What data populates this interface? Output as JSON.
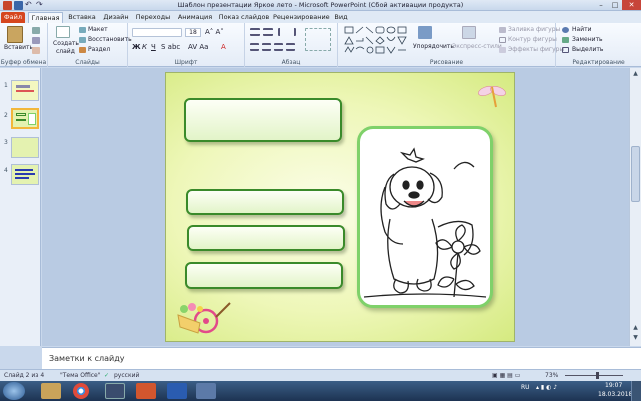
{
  "window": {
    "title": "Шаблон презентации Яркое лето  -  Microsoft PowerPoint (Сбой активации продукта)",
    "minimize": "–",
    "maximize": "□",
    "close": "✕"
  },
  "tabs": [
    {
      "label": "Файл"
    },
    {
      "label": "Главная"
    },
    {
      "label": "Вставка"
    },
    {
      "label": "Дизайн"
    },
    {
      "label": "Переходы"
    },
    {
      "label": "Анимация"
    },
    {
      "label": "Показ слайдов"
    },
    {
      "label": "Рецензирование"
    },
    {
      "label": "Вид"
    }
  ],
  "ribbon": {
    "clipboard": {
      "paste": "Вставить",
      "group": "Буфер обмена"
    },
    "slides": {
      "new_slide_l1": "Создать",
      "new_slide_l2": "слайд",
      "layout": "Макет",
      "reset": "Восстановить",
      "section": "Раздел",
      "group": "Слайды"
    },
    "font": {
      "group": "Шрифт",
      "size": "18"
    },
    "paragraph": {
      "group": "Абзац"
    },
    "drawing": {
      "arrange": "Упорядочить",
      "quick_styles": "Экспресс-стили",
      "fill": "Заливка фигуры",
      "outline": "Контур фигуры",
      "effects": "Эффекты фигуры",
      "group": "Рисование"
    },
    "editing": {
      "find": "Найти",
      "replace": "Заменить",
      "select": "Выделить",
      "group": "Редактирование"
    }
  },
  "slides_panel": {
    "items": [
      {
        "num": "1",
        "selected": false
      },
      {
        "num": "2",
        "selected": true
      },
      {
        "num": "3",
        "selected": false
      },
      {
        "num": "4",
        "selected": false
      }
    ]
  },
  "notes": {
    "placeholder": "Заметки к слайду"
  },
  "status": {
    "slide": "Слайд 2 из 4",
    "theme": "\"Тема Office\"",
    "language": "русский",
    "zoom": "73%"
  },
  "tray": {
    "lang": "RU",
    "time": "19:07",
    "date": "18.03.2018"
  },
  "colors": {
    "accent_file_tab": "#d6461e",
    "frame_green": "#3a8a2a",
    "picture_frame": "#7fd16a"
  }
}
